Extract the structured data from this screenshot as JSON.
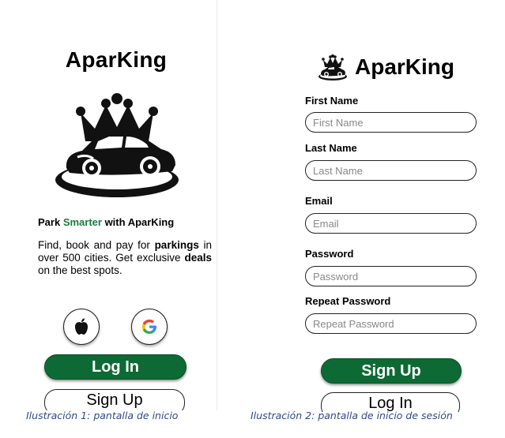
{
  "screen1": {
    "title": "AparKing",
    "tagline_start": "Park ",
    "tagline_accent": "Smarter",
    "tagline_end": " with AparKing",
    "desc_1": "Find, book and pay for ",
    "desc_bold1": "parkings",
    "desc_2": " in over 500 cities. Get exclusive ",
    "desc_bold2": "deals",
    "desc_3": " on the best spots.",
    "apple_icon": "apple-icon",
    "google_icon": "google-icon",
    "login_label": "Log In",
    "signup_label": "Sign Up",
    "caption": "Ilustración 1: pantalla de inicio"
  },
  "screen2": {
    "title": "AparKing",
    "fields": [
      {
        "label": "First Name",
        "placeholder": "First Name"
      },
      {
        "label": "Last Name",
        "placeholder": "Last Name"
      },
      {
        "label": "Email",
        "placeholder": "Email"
      },
      {
        "label": "Password",
        "placeholder": "Password"
      },
      {
        "label": "Repeat Password",
        "placeholder": "Repeat Password"
      }
    ],
    "signup_label": "Sign Up",
    "login_label": "Log In",
    "caption": "Ilustración 2: pantalla de inicio de sesión"
  },
  "colors": {
    "brand_green": "#0e6a34",
    "accent_green": "#1e7a3e",
    "caption_blue": "#2f4b8a"
  }
}
